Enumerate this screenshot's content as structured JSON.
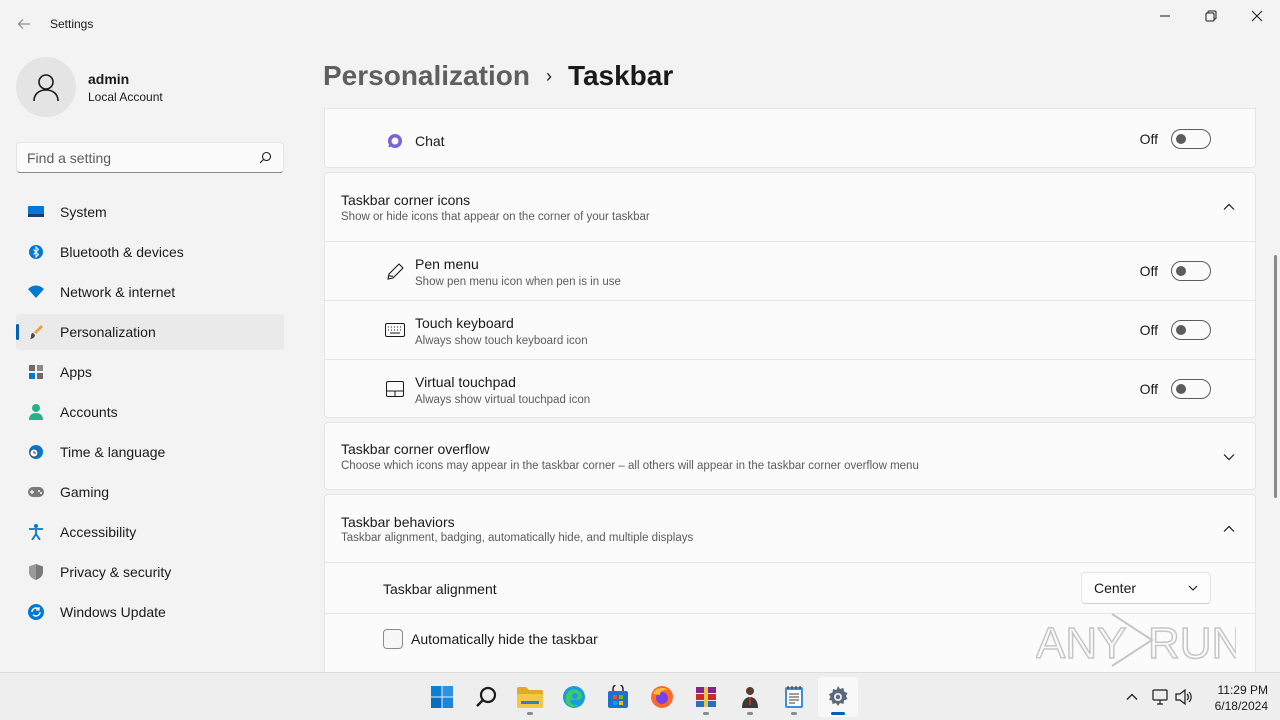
{
  "window": {
    "title": "Settings",
    "back_glyph": "←",
    "minimize_glyph": "—",
    "maximize_glyph": "❐",
    "close_glyph": "✕"
  },
  "profile": {
    "name": "admin",
    "account_type": "Local Account"
  },
  "search": {
    "placeholder": "Find a setting"
  },
  "sidebar": {
    "items": [
      {
        "label": "System",
        "icon": "system-icon"
      },
      {
        "label": "Bluetooth & devices",
        "icon": "bluetooth-icon"
      },
      {
        "label": "Network & internet",
        "icon": "wifi-icon"
      },
      {
        "label": "Personalization",
        "icon": "brush-icon",
        "active": true
      },
      {
        "label": "Apps",
        "icon": "apps-icon"
      },
      {
        "label": "Accounts",
        "icon": "accounts-icon"
      },
      {
        "label": "Time & language",
        "icon": "clock-globe-icon"
      },
      {
        "label": "Gaming",
        "icon": "gamepad-icon"
      },
      {
        "label": "Accessibility",
        "icon": "accessibility-icon"
      },
      {
        "label": "Privacy & security",
        "icon": "shield-icon"
      },
      {
        "label": "Windows Update",
        "icon": "update-icon"
      }
    ]
  },
  "breadcrumb": {
    "parent": "Personalization",
    "separator": "›",
    "current": "Taskbar"
  },
  "chat": {
    "title": "Chat",
    "state": "Off"
  },
  "corner_icons": {
    "title": "Taskbar corner icons",
    "subtitle": "Show or hide icons that appear on the corner of your taskbar",
    "items": [
      {
        "title": "Pen menu",
        "subtitle": "Show pen menu icon when pen is in use",
        "state": "Off"
      },
      {
        "title": "Touch keyboard",
        "subtitle": "Always show touch keyboard icon",
        "state": "Off"
      },
      {
        "title": "Virtual touchpad",
        "subtitle": "Always show virtual touchpad icon",
        "state": "Off"
      }
    ]
  },
  "corner_overflow": {
    "title": "Taskbar corner overflow",
    "subtitle": "Choose which icons may appear in the taskbar corner – all others will appear in the taskbar corner overflow menu"
  },
  "behaviors": {
    "title": "Taskbar behaviors",
    "subtitle": "Taskbar alignment, badging, automatically hide, and multiple displays",
    "alignment_label": "Taskbar alignment",
    "alignment_value": "Center",
    "autohide_label": "Automatically hide the taskbar"
  },
  "watermark": {
    "text_left": "ANY",
    "text_right": "RUN"
  },
  "taskbar": {
    "apps": [
      "start-icon",
      "search-icon",
      "file-explorer-icon",
      "edge-icon",
      "store-icon",
      "firefox-icon",
      "winrar-icon",
      "agent-icon",
      "notepad-icon",
      "settings-icon"
    ],
    "time": "11:29 PM",
    "date": "6/18/2024"
  },
  "colors": {
    "accent": "#005fb8",
    "background": "#f3f3f3",
    "card": "#fbfbfb"
  }
}
